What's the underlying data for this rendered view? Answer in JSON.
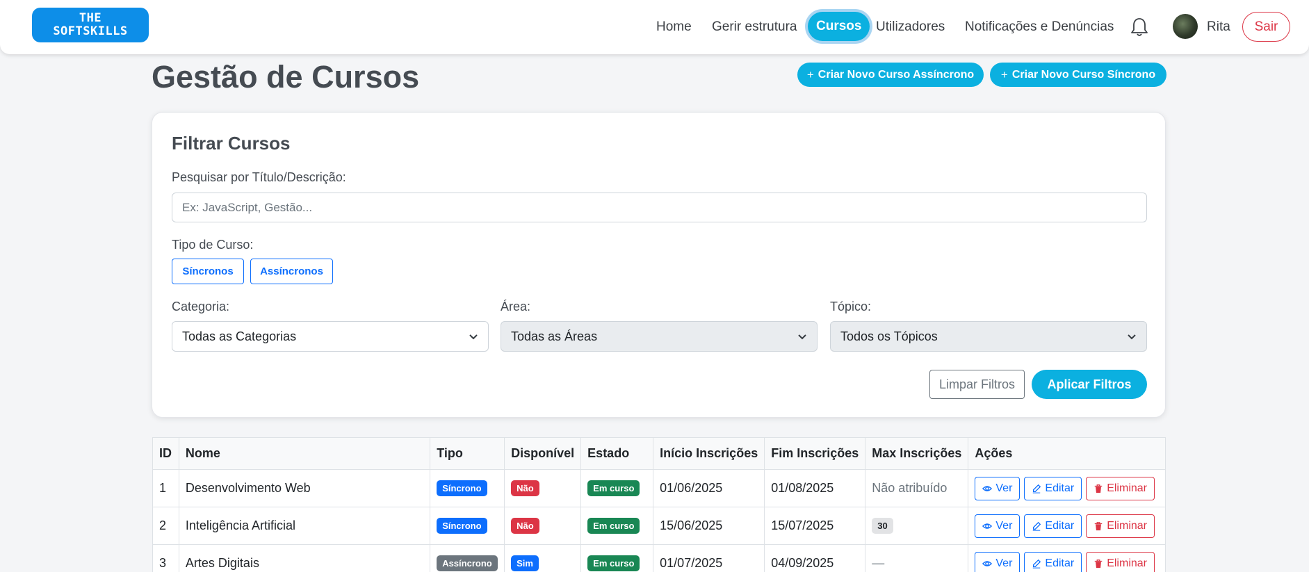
{
  "header": {
    "logo_line1": "THE",
    "logo_line2": "SOFTSKILLS",
    "nav": [
      "Home",
      "Gerir estrutura",
      "Cursos",
      "Utilizadores",
      "Notificações e Denúncias"
    ],
    "active_nav": "Cursos",
    "username": "Rita",
    "logout_label": "Sair"
  },
  "page": {
    "title": "Gestão de Cursos",
    "btn_async": "Criar Novo Curso Assíncrono",
    "btn_sync": "Criar Novo Curso Síncrono"
  },
  "filters": {
    "title": "Filtrar Cursos",
    "search_label": "Pesquisar por Título/Descrição:",
    "search_placeholder": "Ex: JavaScript, Gestão...",
    "search_value": "",
    "type_label": "Tipo de Curso:",
    "type_sync": "Síncronos",
    "type_async": "Assíncronos",
    "category_label": "Categoria:",
    "category_value": "Todas as Categorias",
    "area_label": "Área:",
    "area_value": "Todas as Áreas",
    "topic_label": "Tópico:",
    "topic_value": "Todos os Tópicos",
    "clear_label": "Limpar Filtros",
    "apply_label": "Aplicar Filtros"
  },
  "table": {
    "headers": [
      "ID",
      "Nome",
      "Tipo",
      "Disponível",
      "Estado",
      "Início Inscrições",
      "Fim Inscrições",
      "Max Inscrições",
      "Ações"
    ],
    "actions": {
      "view": "Ver",
      "edit": "Editar",
      "delete": "Eliminar"
    },
    "rows": [
      {
        "id": "1",
        "nome": "Desenvolvimento Web",
        "tipo": "Síncrono",
        "disponivel": "Não",
        "estado": "Em curso",
        "inicio": "01/06/2025",
        "fim": "01/08/2025",
        "max": "Não atribuído"
      },
      {
        "id": "2",
        "nome": "Inteligência Artificial",
        "tipo": "Síncrono",
        "disponivel": "Não",
        "estado": "Em curso",
        "inicio": "15/06/2025",
        "fim": "15/07/2025",
        "max": "30"
      },
      {
        "id": "3",
        "nome": "Artes Digitais",
        "tipo": "Assíncrono",
        "disponivel": "Sim",
        "estado": "Em curso",
        "inicio": "01/07/2025",
        "fim": "04/09/2025",
        "max": "—"
      }
    ]
  },
  "colors": {
    "accent": "#0bb0e0",
    "logo": "#0d8ee8",
    "primary": "#0d6efd",
    "danger": "#dc3545",
    "success": "#198754",
    "secondary": "#6c757d"
  }
}
